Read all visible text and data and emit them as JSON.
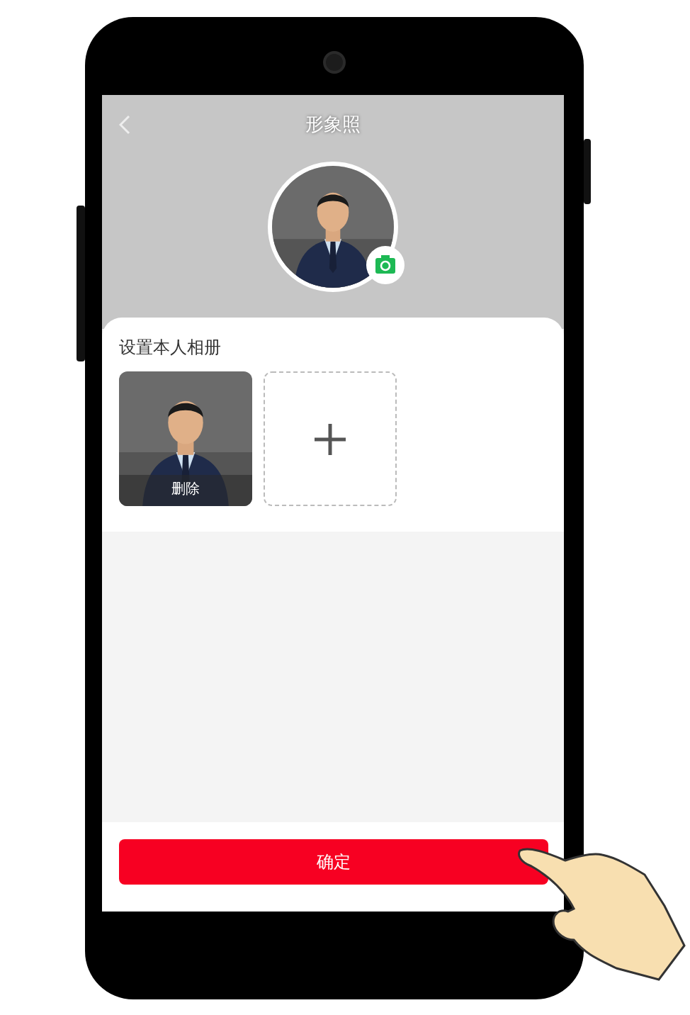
{
  "header": {
    "title": "形象照"
  },
  "album": {
    "title": "设置本人相册",
    "tiles": [
      {
        "label": "删除"
      },
      {
        "kind": "add"
      }
    ]
  },
  "confirm_button": "确定"
}
